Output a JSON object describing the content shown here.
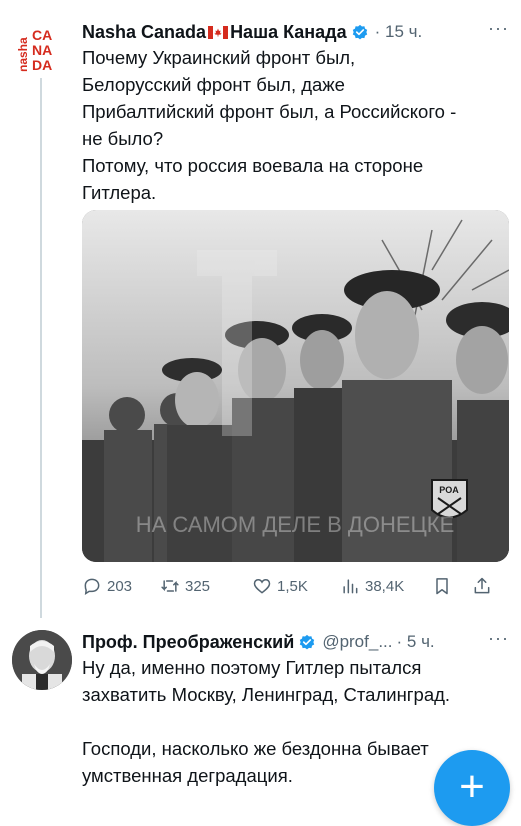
{
  "tweet": {
    "author_name": "Nasha Canada",
    "author_name_ru": "Наша Канада",
    "avatar_text": [
      "nasha",
      "CA",
      "NA",
      "DA"
    ],
    "time": "15 ч.",
    "more": "···",
    "text_lines": [
      "Почему Украинский фронт был,",
      "Белорусский фронт был, даже",
      "Прибалтийский фронт был, а Российского -",
      "не было?",
      "Потому, что россия воевала на стороне",
      "Гитлера."
    ],
    "photo_watermark": "НА САМОМ ДЕЛЕ В ДОНЕЦКЕ",
    "patch_text": "POA",
    "stats": {
      "replies": "203",
      "retweets": "325",
      "likes": "1,5K",
      "views": "38,4K"
    }
  },
  "reply": {
    "author_name": "Проф. Преображенский",
    "handle": "@prof_...",
    "time": "5 ч.",
    "more": "···",
    "paragraph1_lines": [
      "Ну да, именно поэтому Гитлер пытался",
      "захватить Москву, Ленинград, Сталинград."
    ],
    "paragraph2_lines": [
      "Господи, насколько же бездонна бывает",
      "умственная деградация."
    ]
  },
  "fab": {
    "label": "+"
  },
  "colors": {
    "accent": "#1d9bf0",
    "secondary_text": "#536471",
    "canada_red": "#d52b1e"
  }
}
